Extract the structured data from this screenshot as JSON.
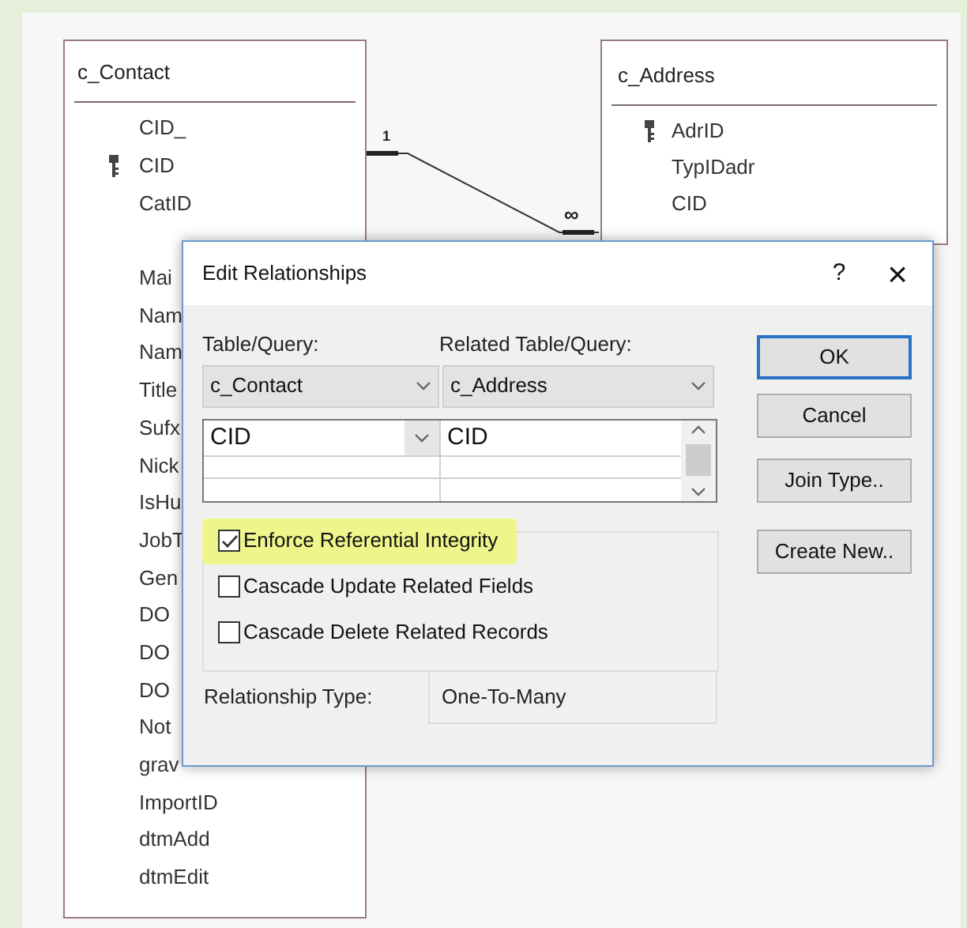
{
  "tables": [
    {
      "title": "c_Contact",
      "fields": [
        {
          "name": "CID_",
          "key": false
        },
        {
          "name": "CID",
          "key": true
        },
        {
          "name": "CatID",
          "key": false
        },
        {
          "name": "Mai",
          "key": false
        },
        {
          "name": "Nam",
          "key": false
        },
        {
          "name": "Nam",
          "key": false
        },
        {
          "name": "Title",
          "key": false
        },
        {
          "name": "Sufx",
          "key": false
        },
        {
          "name": "Nick",
          "key": false
        },
        {
          "name": "IsHu",
          "key": false
        },
        {
          "name": "JobT",
          "key": false
        },
        {
          "name": "Gen",
          "key": false
        },
        {
          "name": "DO",
          "key": false
        },
        {
          "name": "DO",
          "key": false
        },
        {
          "name": "DO",
          "key": false
        },
        {
          "name": "Not",
          "key": false
        },
        {
          "name": "grav",
          "key": false
        },
        {
          "name": "ImportID",
          "key": false
        },
        {
          "name": "dtmAdd",
          "key": false
        },
        {
          "name": "dtmEdit",
          "key": false
        }
      ]
    },
    {
      "title": "c_Address",
      "fields": [
        {
          "name": "AdrID",
          "key": true
        },
        {
          "name": "TypIDadr",
          "key": false
        },
        {
          "name": "CID",
          "key": false
        }
      ]
    }
  ],
  "relationship": {
    "one_label": "1",
    "many_label": "∞"
  },
  "dialog": {
    "title": "Edit Relationships",
    "help": "?",
    "close": "×",
    "table_label": "Table/Query:",
    "related_label": "Related Table/Query:",
    "table": "c_Contact",
    "related_table": "c_Address",
    "field_rows": [
      {
        "field": "CID",
        "related_field": "CID"
      }
    ],
    "options": [
      {
        "label": "Enforce Referential Integrity",
        "checked": true,
        "highlighted": true
      },
      {
        "label": "Cascade Update Related Fields",
        "checked": false,
        "highlighted": false
      },
      {
        "label": "Cascade Delete Related Records",
        "checked": false,
        "highlighted": false
      }
    ],
    "relationship_type_label": "Relationship Type:",
    "relationship_type": "One-To-Many",
    "buttons": [
      {
        "label": "OK",
        "default": true
      },
      {
        "label": "Cancel",
        "default": false
      },
      {
        "label": "Join Type..",
        "default": false
      },
      {
        "label": "Create New..",
        "default": false
      }
    ]
  }
}
